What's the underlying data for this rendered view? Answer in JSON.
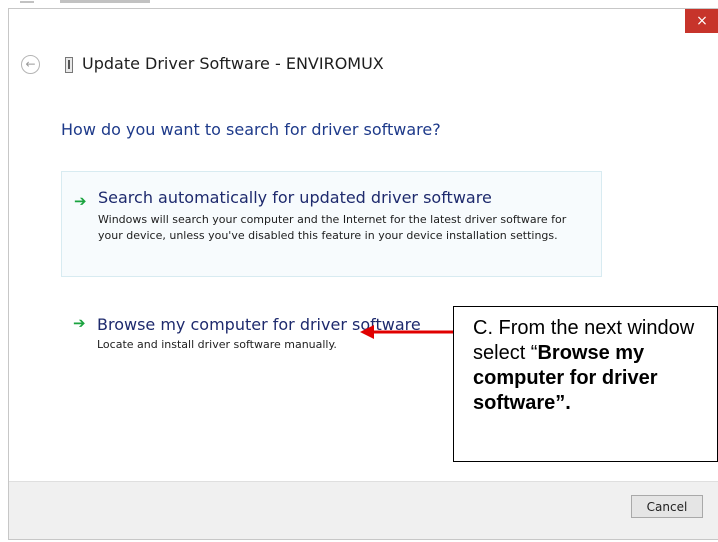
{
  "window": {
    "title": "Update Driver Software - ENVIROMUX",
    "close_glyph": "×",
    "back_glyph": "←"
  },
  "page": {
    "question": "How do you want to search for driver software?"
  },
  "options": [
    {
      "arrow_glyph": "➔",
      "title": "Search automatically for updated driver software",
      "description": "Windows will search your computer and the Internet for the latest driver software for your device, unless you've disabled this feature in your device installation settings."
    },
    {
      "arrow_glyph": "➔",
      "title": "Browse my computer for driver software",
      "description": "Locate and install driver software manually."
    }
  ],
  "footer": {
    "cancel_label": "Cancel"
  },
  "annotation": {
    "line1": "C. From the next window",
    "line2_prefix": "select “",
    "line2_bold": "Browse my computer for driver software”.",
    "arrow_color": "#e00000"
  },
  "colors": {
    "close_button": "#c7342b",
    "option_title": "#1e2a6d",
    "question": "#1e3a8a",
    "arrow_green": "#1aa33f"
  }
}
